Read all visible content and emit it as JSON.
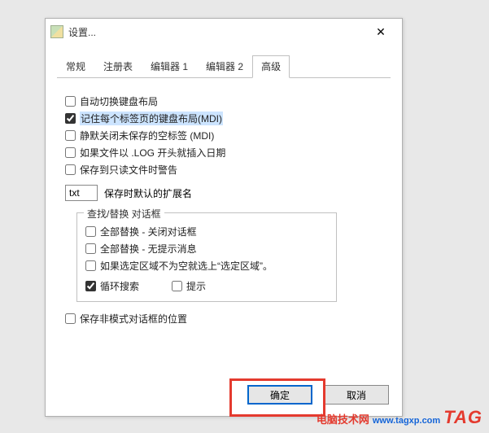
{
  "window": {
    "title": "设置...",
    "close_glyph": "✕"
  },
  "tabs": {
    "t0": "常规",
    "t1": "注册表",
    "t2": "编辑器 1",
    "t3": "编辑器 2",
    "t4": "高级"
  },
  "opts": {
    "autoSwitch": "自动切换键盘布局",
    "rememberLayout": "记住每个标签页的键盘布局(MDI)",
    "silentClose": "静默关闭未保存的空标签 (MDI)",
    "logInsertDate": "如果文件以 .LOG 开头就插入日期",
    "readonlyWarn": "保存到只读文件时警告",
    "extLabel": "保存时默认的扩展名",
    "extValue": "txt",
    "groupTitle": "查找/替换 对话框",
    "replaceClose": "全部替换 - 关闭对话框",
    "replaceNoMsg": "全部替换 - 无提示消息",
    "autoSelectArea": "如果选定区域不为空就选上“选定区域”。",
    "wrapSearch": "循环搜索",
    "hint": "提示",
    "savePos": "保存非模式对话框的位置"
  },
  "buttons": {
    "ok": "确定",
    "cancel": "取消"
  },
  "watermark": {
    "cn": "电脑技术网",
    "url": "www.tagxp.com",
    "tag": "TAG"
  },
  "state": {
    "rememberLayout": true,
    "wrapSearch": true
  }
}
